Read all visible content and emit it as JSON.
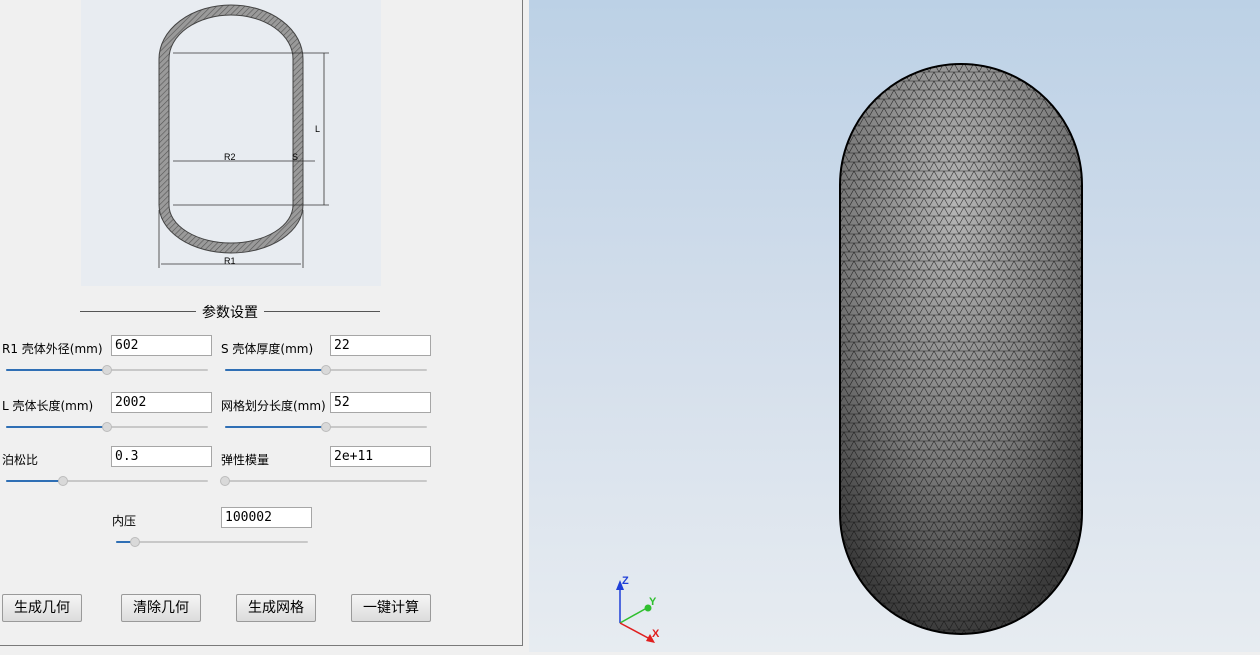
{
  "diagram": {
    "labels": {
      "r2": "R2",
      "s": "S",
      "l": "L",
      "r1": "R1"
    }
  },
  "section_title": "参数设置",
  "params": {
    "r1": {
      "label": "R1 壳体外径(mm)",
      "value": "602",
      "slider": 0.5
    },
    "s": {
      "label": "S 壳体厚度(mm)",
      "value": "22",
      "slider": 0.5
    },
    "l": {
      "label": "L 壳体长度(mm)",
      "value": "2002",
      "slider": 0.5
    },
    "mesh": {
      "label": "网格划分长度(mm)",
      "value": "52",
      "slider": 0.5
    },
    "poisson": {
      "label": "泊松比",
      "value": "0.3",
      "slider": 0.28
    },
    "modulus": {
      "label": "弹性模量",
      "value": "2e+11",
      "slider": 0.0
    },
    "pressure": {
      "label": "内压",
      "value": "100002",
      "slider": 0.1
    }
  },
  "buttons": {
    "generate_geometry": "生成几何",
    "clear_geometry": "清除几何",
    "generate_mesh": "生成网格",
    "one_click_compute": "一键计算"
  },
  "axes": {
    "z": "Z",
    "y": "Y",
    "x": "X",
    "colors": {
      "z": "#1f3fd8",
      "y": "#2fbf2f",
      "x": "#e01e1e"
    }
  }
}
